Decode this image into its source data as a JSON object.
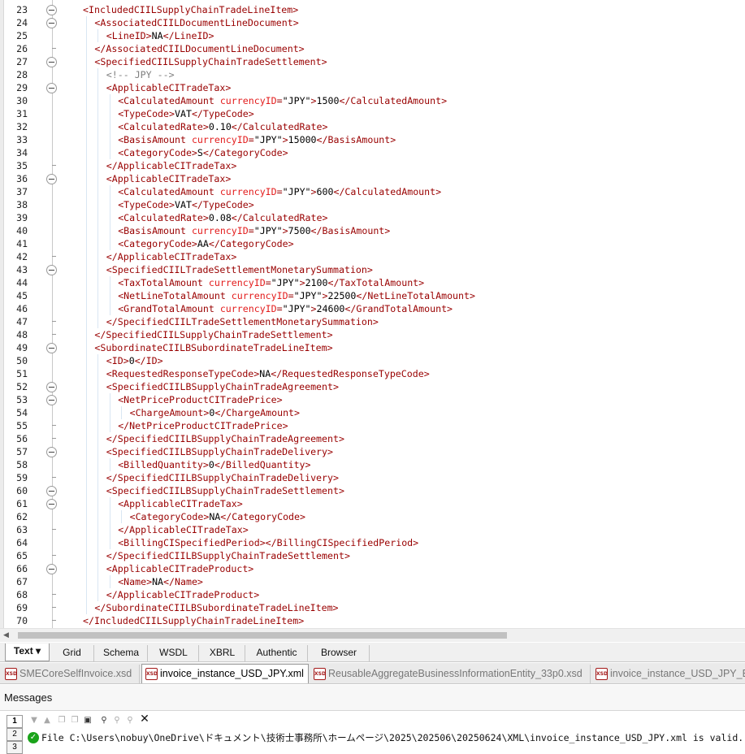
{
  "editor": {
    "lines": [
      {
        "n": "23",
        "depth": 0,
        "fold": true,
        "parts": [
          [
            "t",
            "<IncludedCIILSupplyChainTradeLineItem>"
          ]
        ]
      },
      {
        "n": "24",
        "depth": 1,
        "fold": true,
        "parts": [
          [
            "t",
            "<AssociatedCIILDocumentLineDocument>"
          ]
        ]
      },
      {
        "n": "25",
        "depth": 2,
        "parts": [
          [
            "t",
            "<LineID>"
          ],
          [
            "x",
            "NA"
          ],
          [
            "t",
            "</LineID>"
          ]
        ]
      },
      {
        "n": "26",
        "depth": 1,
        "end": true,
        "parts": [
          [
            "t",
            "</AssociatedCIILDocumentLineDocument>"
          ]
        ]
      },
      {
        "n": "27",
        "depth": 1,
        "fold": true,
        "parts": [
          [
            "t",
            "<SpecifiedCIILSupplyChainTradeSettlement>"
          ]
        ]
      },
      {
        "n": "28",
        "depth": 2,
        "parts": [
          [
            "c",
            "<!-- JPY -->"
          ]
        ]
      },
      {
        "n": "29",
        "depth": 2,
        "fold": true,
        "parts": [
          [
            "t",
            "<ApplicableCITradeTax>"
          ]
        ]
      },
      {
        "n": "30",
        "depth": 3,
        "parts": [
          [
            "t",
            "<CalculatedAmount "
          ],
          [
            "a",
            "currencyID"
          ],
          [
            "t",
            "="
          ],
          [
            "v",
            "\"JPY\""
          ],
          [
            "t",
            ">"
          ],
          [
            "x",
            "1500"
          ],
          [
            "t",
            "</CalculatedAmount>"
          ]
        ]
      },
      {
        "n": "31",
        "depth": 3,
        "parts": [
          [
            "t",
            "<TypeCode>"
          ],
          [
            "x",
            "VAT"
          ],
          [
            "t",
            "</TypeCode>"
          ]
        ]
      },
      {
        "n": "32",
        "depth": 3,
        "parts": [
          [
            "t",
            "<CalculatedRate>"
          ],
          [
            "x",
            "0.10"
          ],
          [
            "t",
            "</CalculatedRate>"
          ]
        ]
      },
      {
        "n": "33",
        "depth": 3,
        "parts": [
          [
            "t",
            "<BasisAmount "
          ],
          [
            "a",
            "currencyID"
          ],
          [
            "t",
            "="
          ],
          [
            "v",
            "\"JPY\""
          ],
          [
            "t",
            ">"
          ],
          [
            "x",
            "15000"
          ],
          [
            "t",
            "</BasisAmount>"
          ]
        ]
      },
      {
        "n": "34",
        "depth": 3,
        "parts": [
          [
            "t",
            "<CategoryCode>"
          ],
          [
            "x",
            "S"
          ],
          [
            "t",
            "</CategoryCode>"
          ]
        ]
      },
      {
        "n": "35",
        "depth": 2,
        "end": true,
        "parts": [
          [
            "t",
            "</ApplicableCITradeTax>"
          ]
        ]
      },
      {
        "n": "36",
        "depth": 2,
        "fold": true,
        "parts": [
          [
            "t",
            "<ApplicableCITradeTax>"
          ]
        ]
      },
      {
        "n": "37",
        "depth": 3,
        "parts": [
          [
            "t",
            "<CalculatedAmount "
          ],
          [
            "a",
            "currencyID"
          ],
          [
            "t",
            "="
          ],
          [
            "v",
            "\"JPY\""
          ],
          [
            "t",
            ">"
          ],
          [
            "x",
            "600"
          ],
          [
            "t",
            "</CalculatedAmount>"
          ]
        ]
      },
      {
        "n": "38",
        "depth": 3,
        "parts": [
          [
            "t",
            "<TypeCode>"
          ],
          [
            "x",
            "VAT"
          ],
          [
            "t",
            "</TypeCode>"
          ]
        ]
      },
      {
        "n": "39",
        "depth": 3,
        "parts": [
          [
            "t",
            "<CalculatedRate>"
          ],
          [
            "x",
            "0.08"
          ],
          [
            "t",
            "</CalculatedRate>"
          ]
        ]
      },
      {
        "n": "40",
        "depth": 3,
        "parts": [
          [
            "t",
            "<BasisAmount "
          ],
          [
            "a",
            "currencyID"
          ],
          [
            "t",
            "="
          ],
          [
            "v",
            "\"JPY\""
          ],
          [
            "t",
            ">"
          ],
          [
            "x",
            "7500"
          ],
          [
            "t",
            "</BasisAmount>"
          ]
        ]
      },
      {
        "n": "41",
        "depth": 3,
        "parts": [
          [
            "t",
            "<CategoryCode>"
          ],
          [
            "x",
            "AA"
          ],
          [
            "t",
            "</CategoryCode>"
          ]
        ]
      },
      {
        "n": "42",
        "depth": 2,
        "end": true,
        "parts": [
          [
            "t",
            "</ApplicableCITradeTax>"
          ]
        ]
      },
      {
        "n": "43",
        "depth": 2,
        "fold": true,
        "parts": [
          [
            "t",
            "<SpecifiedCIILTradeSettlementMonetarySummation>"
          ]
        ]
      },
      {
        "n": "44",
        "depth": 3,
        "parts": [
          [
            "t",
            "<TaxTotalAmount "
          ],
          [
            "a",
            "currencyID"
          ],
          [
            "t",
            "="
          ],
          [
            "v",
            "\"JPY\""
          ],
          [
            "t",
            ">"
          ],
          [
            "x",
            "2100"
          ],
          [
            "t",
            "</TaxTotalAmount>"
          ]
        ]
      },
      {
        "n": "45",
        "depth": 3,
        "parts": [
          [
            "t",
            "<NetLineTotalAmount "
          ],
          [
            "a",
            "currencyID"
          ],
          [
            "t",
            "="
          ],
          [
            "v",
            "\"JPY\""
          ],
          [
            "t",
            ">"
          ],
          [
            "x",
            "22500"
          ],
          [
            "t",
            "</NetLineTotalAmount>"
          ]
        ]
      },
      {
        "n": "46",
        "depth": 3,
        "parts": [
          [
            "t",
            "<GrandTotalAmount "
          ],
          [
            "a",
            "currencyID"
          ],
          [
            "t",
            "="
          ],
          [
            "v",
            "\"JPY\""
          ],
          [
            "t",
            ">"
          ],
          [
            "x",
            "24600"
          ],
          [
            "t",
            "</GrandTotalAmount>"
          ]
        ]
      },
      {
        "n": "47",
        "depth": 2,
        "end": true,
        "parts": [
          [
            "t",
            "</SpecifiedCIILTradeSettlementMonetarySummation>"
          ]
        ]
      },
      {
        "n": "48",
        "depth": 1,
        "end": true,
        "parts": [
          [
            "t",
            "</SpecifiedCIILSupplyChainTradeSettlement>"
          ]
        ]
      },
      {
        "n": "49",
        "depth": 1,
        "fold": true,
        "parts": [
          [
            "t",
            "<SubordinateCIILBSubordinateTradeLineItem>"
          ]
        ]
      },
      {
        "n": "50",
        "depth": 2,
        "parts": [
          [
            "t",
            "<ID>"
          ],
          [
            "x",
            "0"
          ],
          [
            "t",
            "</ID>"
          ]
        ]
      },
      {
        "n": "51",
        "depth": 2,
        "parts": [
          [
            "t",
            "<RequestedResponseTypeCode>"
          ],
          [
            "x",
            "NA"
          ],
          [
            "t",
            "</RequestedResponseTypeCode>"
          ]
        ]
      },
      {
        "n": "52",
        "depth": 2,
        "fold": true,
        "parts": [
          [
            "t",
            "<SpecifiedCIILBSupplyChainTradeAgreement>"
          ]
        ]
      },
      {
        "n": "53",
        "depth": 3,
        "fold": true,
        "parts": [
          [
            "t",
            "<NetPriceProductCITradePrice>"
          ]
        ]
      },
      {
        "n": "54",
        "depth": 4,
        "parts": [
          [
            "t",
            "<ChargeAmount>"
          ],
          [
            "x",
            "0"
          ],
          [
            "t",
            "</ChargeAmount>"
          ]
        ]
      },
      {
        "n": "55",
        "depth": 3,
        "end": true,
        "parts": [
          [
            "t",
            "</NetPriceProductCITradePrice>"
          ]
        ]
      },
      {
        "n": "56",
        "depth": 2,
        "end": true,
        "parts": [
          [
            "t",
            "</SpecifiedCIILBSupplyChainTradeAgreement>"
          ]
        ]
      },
      {
        "n": "57",
        "depth": 2,
        "fold": true,
        "parts": [
          [
            "t",
            "<SpecifiedCIILBSupplyChainTradeDelivery>"
          ]
        ]
      },
      {
        "n": "58",
        "depth": 3,
        "parts": [
          [
            "t",
            "<BilledQuantity>"
          ],
          [
            "x",
            "0"
          ],
          [
            "t",
            "</BilledQuantity>"
          ]
        ]
      },
      {
        "n": "59",
        "depth": 2,
        "end": true,
        "parts": [
          [
            "t",
            "</SpecifiedCIILBSupplyChainTradeDelivery>"
          ]
        ]
      },
      {
        "n": "60",
        "depth": 2,
        "fold": true,
        "parts": [
          [
            "t",
            "<SpecifiedCIILBSupplyChainTradeSettlement>"
          ]
        ]
      },
      {
        "n": "61",
        "depth": 3,
        "fold": true,
        "parts": [
          [
            "t",
            "<ApplicableCITradeTax>"
          ]
        ]
      },
      {
        "n": "62",
        "depth": 4,
        "parts": [
          [
            "t",
            "<CategoryCode>"
          ],
          [
            "x",
            "NA"
          ],
          [
            "t",
            "</CategoryCode>"
          ]
        ]
      },
      {
        "n": "63",
        "depth": 3,
        "end": true,
        "parts": [
          [
            "t",
            "</ApplicableCITradeTax>"
          ]
        ]
      },
      {
        "n": "64",
        "depth": 3,
        "parts": [
          [
            "t",
            "<BillingCISpecifiedPeriod></BillingCISpecifiedPeriod>"
          ]
        ]
      },
      {
        "n": "65",
        "depth": 2,
        "end": true,
        "parts": [
          [
            "t",
            "</SpecifiedCIILBSupplyChainTradeSettlement>"
          ]
        ]
      },
      {
        "n": "66",
        "depth": 2,
        "fold": true,
        "parts": [
          [
            "t",
            "<ApplicableCITradeProduct>"
          ]
        ]
      },
      {
        "n": "67",
        "depth": 3,
        "parts": [
          [
            "t",
            "<Name>"
          ],
          [
            "x",
            "NA"
          ],
          [
            "t",
            "</Name>"
          ]
        ]
      },
      {
        "n": "68",
        "depth": 2,
        "end": true,
        "parts": [
          [
            "t",
            "</ApplicableCITradeProduct>"
          ]
        ]
      },
      {
        "n": "69",
        "depth": 1,
        "end": true,
        "parts": [
          [
            "t",
            "</SubordinateCIILBSubordinateTradeLineItem>"
          ]
        ]
      },
      {
        "n": "70",
        "depth": 0,
        "end": true,
        "parts": [
          [
            "t",
            "</IncludedCIILSupplyChainTradeLineItem>"
          ]
        ]
      }
    ]
  },
  "view_tabs": [
    "Text",
    "Grid",
    "Schema",
    "WSDL",
    "XBRL",
    "Authentic",
    "Browser"
  ],
  "view_tab_dropdown": "▾",
  "file_tabs": [
    {
      "label": "SMECoreSelfInvoice.xsd",
      "active": false
    },
    {
      "label": "invoice_instance_USD_JPY.xml",
      "active": true
    },
    {
      "label": "ReusableAggregateBusinessInformationEntity_33p0.xsd",
      "active": false
    },
    {
      "label": "invoice_instance_USD_JPY_Err",
      "active": false
    }
  ],
  "file_icon_text": "XSD",
  "messages": {
    "title": "Messages",
    "side_tabs": [
      "1",
      "2",
      "3"
    ],
    "line": "File C:\\Users\\nobuy\\OneDrive\\ドキュメント\\技術士事務所\\ホームページ\\2025\\202506\\20250624\\XML\\invoice_instance_USD_JPY.xml is valid."
  },
  "colors": {
    "tag": "#990000",
    "attr": "#e31c1c",
    "comment": "#7f7f7f",
    "valid": "#1aa31a"
  }
}
